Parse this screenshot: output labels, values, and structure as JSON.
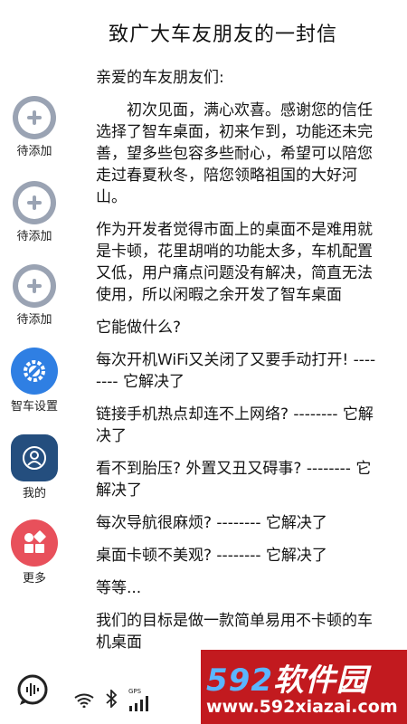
{
  "title": "致广大车友朋友的一封信",
  "sidebar": {
    "items": [
      {
        "label": "待添加",
        "icon": "add-circle-icon"
      },
      {
        "label": "待添加",
        "icon": "add-circle-icon"
      },
      {
        "label": "待添加",
        "icon": "add-circle-icon"
      },
      {
        "label": "智车设置",
        "icon": "gear-wrench-icon"
      },
      {
        "label": "我的",
        "icon": "user-icon"
      },
      {
        "label": "更多",
        "icon": "apps-grid-icon"
      }
    ]
  },
  "letter": {
    "greeting": "亲爱的车友朋友们:",
    "paragraphs": [
      "初次见面，满心欢喜。感谢您的信任选择了智车桌面，初来乍到，功能还未完善，望多些包容多些耐心，希望可以陪您走过春夏秋冬，陪您领略祖国的大好河山。",
      "作为开发者觉得市面上的桌面不是难用就是卡顿，花里胡哨的功能太多，车机配置又低，用户痛点问题没有解决，简直无法使用，所以闲暇之余开发了智车桌面",
      "它能做什么?",
      "每次开机WiFi又关闭了又要手动打开! -------- 它解决了",
      "链接手机热点却连不上网络? -------- 它解决了",
      "看不到胎压? 外置又丑又碍事? -------- 它解决了",
      "每次导航很麻烦? -------- 它解决了",
      "桌面卡顿不美观? -------- 它解决了",
      "等等...",
      "我们的目标是做一款简单易用不卡顿的车机桌面"
    ]
  },
  "bottom_bar": {
    "gps_label": "GPS",
    "icons": [
      "voice-assistant-icon",
      "wifi-icon",
      "bluetooth-icon",
      "gps-signal-icon"
    ]
  },
  "watermark": {
    "logo_number": "592",
    "logo_text": "软件园",
    "url": "www.592xiazai.com"
  },
  "colors": {
    "add_icon": "#9aa3b3",
    "settings": "#2f7fe3",
    "mine": "#244e7e",
    "more": "#e8505b",
    "watermark_bg": "#c21a1f"
  }
}
